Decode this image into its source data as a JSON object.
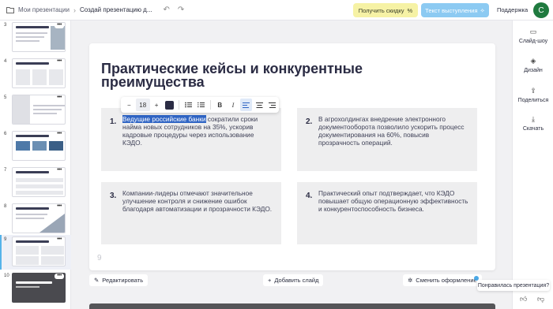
{
  "header": {
    "breadcrumb_root": "Мои презентации",
    "breadcrumb_current": "Создай презентацию д...",
    "discount_label": "Получить скидку",
    "speech_label": "Текст выступления",
    "support_label": "Поддержка",
    "avatar_letter": "C",
    "avatar_color": "#1f7a3f"
  },
  "sidebar": {
    "thumbnails": [
      {
        "num": "3"
      },
      {
        "num": "4"
      },
      {
        "num": "5"
      },
      {
        "num": "6"
      },
      {
        "num": "7"
      },
      {
        "num": "8"
      },
      {
        "num": "9"
      },
      {
        "num": "10"
      }
    ],
    "active_slide": "9",
    "menu_glyph": "•••"
  },
  "slide": {
    "title": "Практические кейсы и конкурентные преимущества",
    "number": "9",
    "cards": [
      {
        "num": "1.",
        "text_selected": "Ведущие российские банки",
        "text_rest": " сократили сроки найма новых сотрудников на 35%, ускорив кадровые процедуры через использование КЭДО."
      },
      {
        "num": "2.",
        "text": "В агрохолдингах внедрение электронного документооборота позволило ускорить процесс документирования на 60%, повысив прозрачность операций."
      },
      {
        "num": "3.",
        "text": "Компании-лидеры отмечают значительное улучшение контроля и снижение ошибок благодаря автоматизации и прозрачности КЭДО."
      },
      {
        "num": "4.",
        "text": "Практический опыт подтверждает, что КЭДО повышает общую операционную эффективность и конкурентоспособность бизнеса."
      }
    ]
  },
  "format_toolbar": {
    "minus": "−",
    "font_size": "18",
    "plus": "+",
    "text_color": "#2b2c44",
    "bold": "B",
    "italic": "I"
  },
  "bottom": {
    "edit_label": "Редактировать",
    "add_slide_label": "Добавить слайд",
    "change_design_label": "Сменить оформление"
  },
  "rightbar": {
    "slideshow_label": "Слайд-шоу",
    "design_label": "Дизайн",
    "share_label": "Поделиться",
    "download_label": "Скачать"
  },
  "feedback": {
    "question": "Понравилась презентация?"
  },
  "colors": {
    "accent": "#55b3ea",
    "selection": "#2f64c4",
    "discount_bg": "#f6f2a5",
    "speech_bg": "#8ccaf2"
  }
}
